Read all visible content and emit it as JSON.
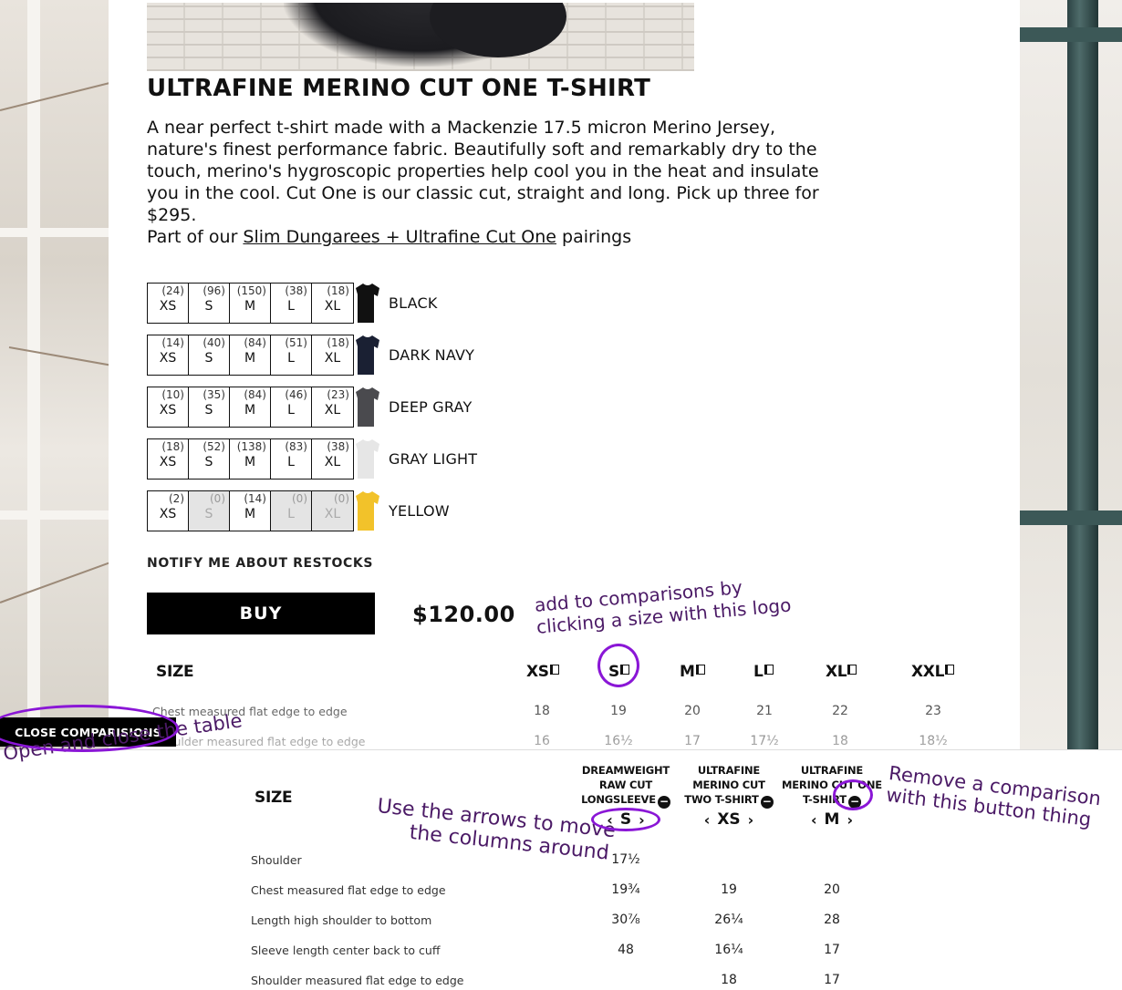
{
  "product": {
    "title": "ULTRAFINE MERINO CUT ONE T-SHIRT",
    "description": "A near perfect t-shirt made with a Mackenzie 17.5 micron Merino Jersey, nature's finest performance fabric. Beautifully soft and remarkably dry to the touch, merino's hygroscopic properties help cool you in the heat and insulate you in the cool. Cut One is our classic cut, straight and long. Pick up three for $295.",
    "pairing_prefix": "Part of our ",
    "pairing_link": "Slim Dungarees + Ultrafine Cut One",
    "pairing_suffix": " pairings",
    "notify_label": "NOTIFY ME ABOUT RESTOCKS",
    "buy_label": "BUY",
    "price": "$120.00"
  },
  "colors": [
    {
      "name": "BLACK",
      "hex": "#111111",
      "sizes": [
        {
          "s": "XS",
          "c": "(24)"
        },
        {
          "s": "S",
          "c": "(96)"
        },
        {
          "s": "M",
          "c": "(150)"
        },
        {
          "s": "L",
          "c": "(38)"
        },
        {
          "s": "XL",
          "c": "(18)"
        }
      ]
    },
    {
      "name": "DARK NAVY",
      "hex": "#1a2033",
      "sizes": [
        {
          "s": "XS",
          "c": "(14)"
        },
        {
          "s": "S",
          "c": "(40)"
        },
        {
          "s": "M",
          "c": "(84)"
        },
        {
          "s": "L",
          "c": "(51)"
        },
        {
          "s": "XL",
          "c": "(18)"
        }
      ]
    },
    {
      "name": "DEEP GRAY",
      "hex": "#4a4a4e",
      "sizes": [
        {
          "s": "XS",
          "c": "(10)"
        },
        {
          "s": "S",
          "c": "(35)"
        },
        {
          "s": "M",
          "c": "(84)"
        },
        {
          "s": "L",
          "c": "(46)"
        },
        {
          "s": "XL",
          "c": "(23)"
        }
      ]
    },
    {
      "name": "GRAY LIGHT",
      "hex": "#e6e6e6",
      "sizes": [
        {
          "s": "XS",
          "c": "(18)"
        },
        {
          "s": "S",
          "c": "(52)"
        },
        {
          "s": "M",
          "c": "(138)"
        },
        {
          "s": "L",
          "c": "(83)"
        },
        {
          "s": "XL",
          "c": "(38)"
        }
      ]
    },
    {
      "name": "YELLOW",
      "hex": "#f2c22a",
      "sizes": [
        {
          "s": "XS",
          "c": "(2)"
        },
        {
          "s": "S",
          "c": "(0)"
        },
        {
          "s": "M",
          "c": "(14)"
        },
        {
          "s": "L",
          "c": "(0)"
        },
        {
          "s": "XL",
          "c": "(0)"
        }
      ]
    }
  ],
  "size_chart": {
    "header": "SIZE",
    "sizes": [
      "XS",
      "S",
      "M",
      "L",
      "XL",
      "XXL"
    ],
    "rows": [
      {
        "label": "Chest measured flat edge to edge",
        "values": [
          "18",
          "19",
          "20",
          "21",
          "22",
          "23"
        ]
      },
      {
        "label": "Shoulder measured flat edge to edge",
        "values": [
          "16",
          "16½",
          "17",
          "17½",
          "18",
          "18½"
        ]
      }
    ]
  },
  "comparison": {
    "close_label": "CLOSE COMPARISIONS",
    "header": "SIZE",
    "columns": [
      {
        "name_lines": [
          "DREAMWEIGHT",
          "RAW CUT",
          "LONGSLEEVE"
        ],
        "size": "S"
      },
      {
        "name_lines": [
          "ULTRAFINE",
          "MERINO CUT",
          "TWO T-SHIRT"
        ],
        "size": "XS"
      },
      {
        "name_lines": [
          "ULTRAFINE",
          "MERINO CUT ONE",
          "T-SHIRT"
        ],
        "size": "M"
      }
    ],
    "rows": [
      {
        "label": "Shoulder",
        "values": [
          "17½",
          "",
          ""
        ]
      },
      {
        "label": "Chest measured flat edge to edge",
        "values": [
          "19¾",
          "19",
          "20"
        ]
      },
      {
        "label": "Length high shoulder to bottom",
        "values": [
          "30⅞",
          "26¼",
          "28"
        ]
      },
      {
        "label": "Sleeve length center back to cuff",
        "values": [
          "48",
          "16¼",
          "17"
        ]
      },
      {
        "label": "Shoulder measured flat edge to edge",
        "values": [
          "",
          "18",
          "17"
        ]
      }
    ]
  },
  "annotations": {
    "add_comparison": [
      "add to comparisons by",
      "clicking a size with this logo"
    ],
    "open_close": "Open and close the table",
    "arrows": [
      "Use the arrows to move",
      "the columns around"
    ],
    "remove": [
      "Remove a comparison",
      "with this button thing"
    ]
  },
  "icons": {
    "compare": "compare-icon",
    "remove": "minus-circle-icon",
    "arrow_left": "chevron-left-icon",
    "arrow_right": "chevron-right-icon",
    "shirt": "tshirt-icon"
  },
  "accent": "#8a16d6"
}
